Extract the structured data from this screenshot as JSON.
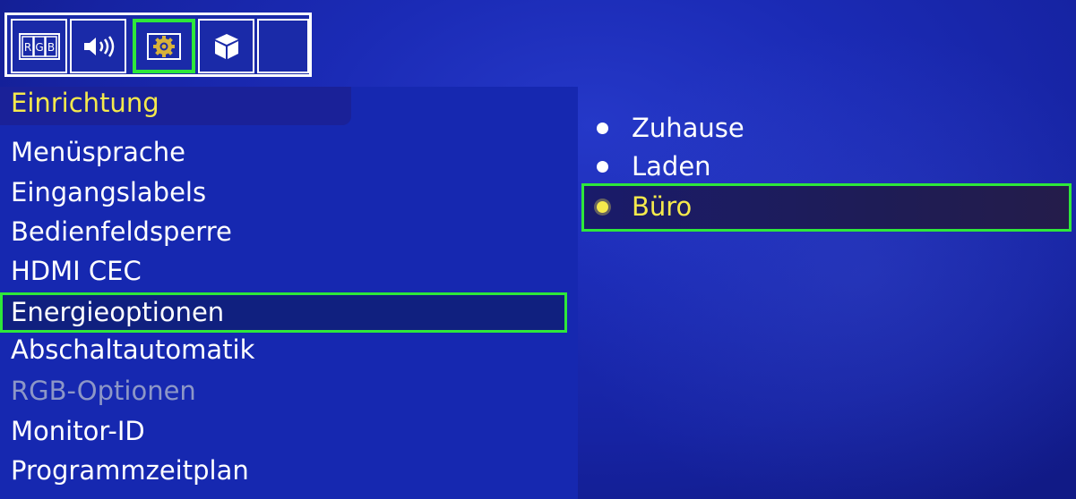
{
  "tabs": [
    {
      "icon": "rgb-icon",
      "text": "RGB"
    },
    {
      "icon": "speaker-icon"
    },
    {
      "icon": "gear-icon"
    },
    {
      "icon": "cube-icon"
    },
    {
      "icon": "blank-icon"
    }
  ],
  "selected_tab": 2,
  "section_title": "Einrichtung",
  "menu": {
    "items": [
      {
        "label": "Menüsprache"
      },
      {
        "label": "Eingangslabels"
      },
      {
        "label": "Bedienfeldsperre"
      },
      {
        "label": "HDMI  CEC"
      },
      {
        "label": "Energieoptionen"
      },
      {
        "label": "Abschaltautomatik"
      },
      {
        "label": "RGB-Optionen"
      },
      {
        "label": "Monitor-ID"
      },
      {
        "label": "Programmzeitplan"
      }
    ],
    "selected_index": 4,
    "disabled_index": 6
  },
  "options": {
    "items": [
      {
        "label": "Zuhause"
      },
      {
        "label": "Laden"
      },
      {
        "label": "Büro"
      }
    ],
    "selected_index": 2
  },
  "colors": {
    "background": "#1b2bb6",
    "title_yellow": "#f5e94c",
    "highlight_green": "#2ee83a",
    "text_white": "#ffffff",
    "disabled_text": "#8d97c7"
  }
}
